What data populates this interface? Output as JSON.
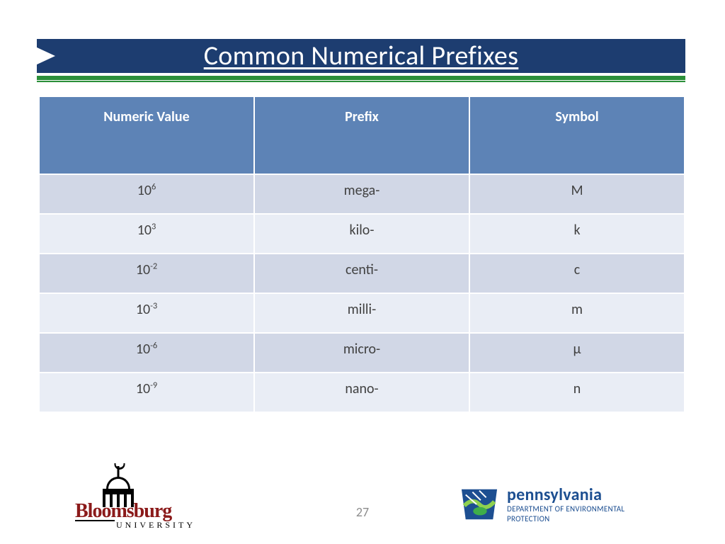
{
  "title": "Common Numerical Prefixes",
  "table": {
    "headers": [
      "Numeric Value",
      "Prefix",
      "Symbol"
    ],
    "rows": [
      {
        "base": "10",
        "exp": "6",
        "prefix": "mega-",
        "symbol": "M"
      },
      {
        "base": "10",
        "exp": "3",
        "prefix": "kilo-",
        "symbol": "k"
      },
      {
        "base": "10",
        "exp": "-2",
        "prefix": "centi-",
        "symbol": "c"
      },
      {
        "base": "10",
        "exp": "-3",
        "prefix": "milli-",
        "symbol": "m"
      },
      {
        "base": "10",
        "exp": "-6",
        "prefix": "micro-",
        "symbol": "μ"
      },
      {
        "base": "10",
        "exp": "-9",
        "prefix": "nano-",
        "symbol": "n"
      }
    ]
  },
  "page_number": "27",
  "logos": {
    "left": {
      "name": "Bloomsburg",
      "subtitle": "UNIVERSITY"
    },
    "right": {
      "name": "pennsylvania",
      "dept_line1": "DEPARTMENT OF ENVIRONMENTAL",
      "dept_line2": "PROTECTION"
    }
  }
}
